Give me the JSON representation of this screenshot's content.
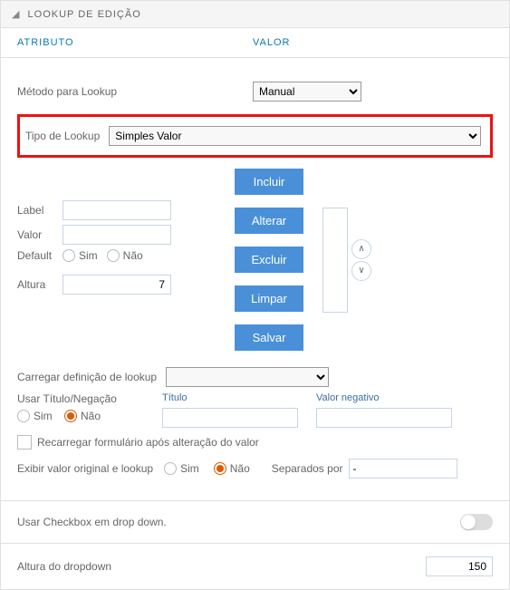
{
  "panel": {
    "title": "LOOKUP DE EDIÇÃO",
    "headers": {
      "attribute": "ATRIBUTO",
      "value": "VALOR"
    }
  },
  "method": {
    "label": "Método para Lookup",
    "options": [
      "Manual"
    ],
    "value": "Manual"
  },
  "lookup_type": {
    "label": "Tipo de Lookup",
    "options": [
      "Simples Valor"
    ],
    "value": "Simples Valor"
  },
  "fields": {
    "label_label": "Label",
    "valor_label": "Valor",
    "default_label": "Default",
    "altura_label": "Altura",
    "altura_value": "7",
    "sim": "Sim",
    "nao": "Não"
  },
  "buttons": {
    "incluir": "Incluir",
    "alterar": "Alterar",
    "excluir": "Excluir",
    "limpar": "Limpar",
    "salvar": "Salvar"
  },
  "carregar": {
    "label": "Carregar definição de lookup",
    "value": ""
  },
  "titulo_negacao": {
    "usar_label": "Usar Título/Negação",
    "titulo_label": "Título",
    "valor_neg_label": "Valor negativo"
  },
  "recarregar_label": "Recarregar formulário após alteração do valor",
  "exibir_original": {
    "label": "Exibir valor original e lookup",
    "separados_label": "Separados por",
    "separados_value": "-"
  },
  "checkbox_dropdown_label": "Usar Checkbox em drop down.",
  "altura_dropdown": {
    "label": "Altura do dropdown",
    "value": "150"
  }
}
